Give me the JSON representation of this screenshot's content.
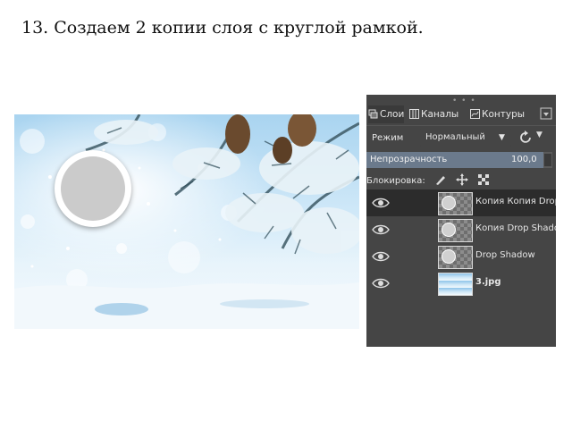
{
  "heading": "13. Создаем 2 копии слоя с круглой рамкой.",
  "panel": {
    "tabs": [
      {
        "label": "Слои",
        "icon": "layers-icon"
      },
      {
        "label": "Каналы",
        "icon": "channels-icon"
      },
      {
        "label": "Контуры",
        "icon": "paths-icon"
      }
    ],
    "mode_label": "Режим",
    "mode_value": "Нормальный",
    "opacity_label": "Непрозрачность",
    "opacity_value": "100,0",
    "lock_label": "Блокировка:",
    "layers": [
      {
        "name": "Копия Копия Drop Shadow",
        "visible": true,
        "selected": true
      },
      {
        "name": "Копия Drop Shadow",
        "visible": true,
        "selected": false
      },
      {
        "name": "Drop Shadow",
        "visible": true,
        "selected": false
      },
      {
        "name": "3.jpg",
        "visible": true,
        "selected": false
      }
    ]
  },
  "colors": {
    "panel_bg": "#454545",
    "selected_row": "#2c2c2c",
    "frame_fill": "#cbcbcb"
  }
}
